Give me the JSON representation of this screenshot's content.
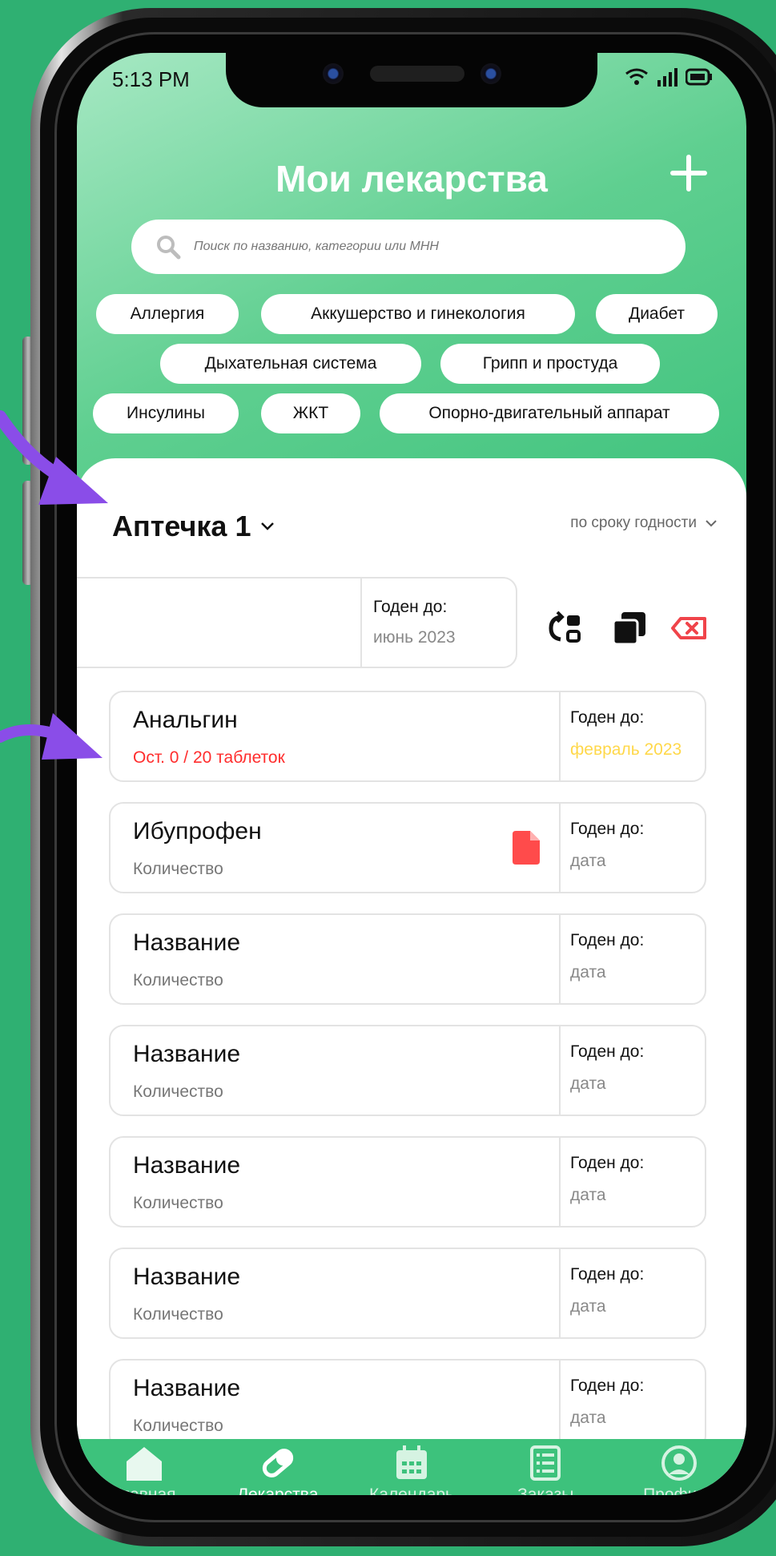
{
  "status_bar": {
    "time": "5:13 PM"
  },
  "header": {
    "title": "Мои лекарства"
  },
  "search": {
    "placeholder": "Поиск по названию, категории или МНН"
  },
  "categories": [
    "Аллергия",
    "Аккушерство и гинекология",
    "Диабет",
    "Дыхательная система",
    "Грипп и простуда",
    "Инсулины",
    "ЖКТ",
    "Опорно-двигательный аппарат"
  ],
  "kit": {
    "name": "Аптечка 1",
    "sort_label": "по сроку годности"
  },
  "swiped_item": {
    "expiry_label": "Годен до:",
    "expiry_value": "июнь 2023"
  },
  "medicines": [
    {
      "name": "Анальгин",
      "quantity": "Ост. 0 / 20 таблеток",
      "expiry_label": "Годен до:",
      "expiry_value": "февраль 2023"
    },
    {
      "name": "Ибупрофен",
      "quantity": "Количество",
      "expiry_label": "Годен до:",
      "expiry_value": "дата"
    },
    {
      "name": "Название",
      "quantity": "Количество",
      "expiry_label": "Годен до:",
      "expiry_value": "дата"
    },
    {
      "name": "Название",
      "quantity": "Количество",
      "expiry_label": "Годен до:",
      "expiry_value": "дата"
    },
    {
      "name": "Название",
      "quantity": "Количество",
      "expiry_label": "Годен до:",
      "expiry_value": "дата"
    },
    {
      "name": "Название",
      "quantity": "Количество",
      "expiry_label": "Годен до:",
      "expiry_value": "дата"
    },
    {
      "name": "Название",
      "quantity": "Количество",
      "expiry_label": "Годен до:",
      "expiry_value": "дата"
    }
  ],
  "tabs": [
    {
      "label": "Главная",
      "icon": "home-icon"
    },
    {
      "label": "Лекарства",
      "icon": "pills-icon"
    },
    {
      "label": "Календарь",
      "icon": "calendar-icon"
    },
    {
      "label": "Заказы",
      "icon": "orders-icon"
    },
    {
      "label": "Профиль",
      "icon": "profile-icon"
    }
  ],
  "colors": {
    "background": "#2fb072",
    "header_green": "#3dc27c",
    "warning_red": "#ff2d2d",
    "expiry_yellow": "#ffd84a",
    "delete_red": "#f0444a",
    "arrow_purple": "#8a4de8",
    "tab_active": "#ffffff",
    "tab_inactive": "#d6f3e2"
  }
}
